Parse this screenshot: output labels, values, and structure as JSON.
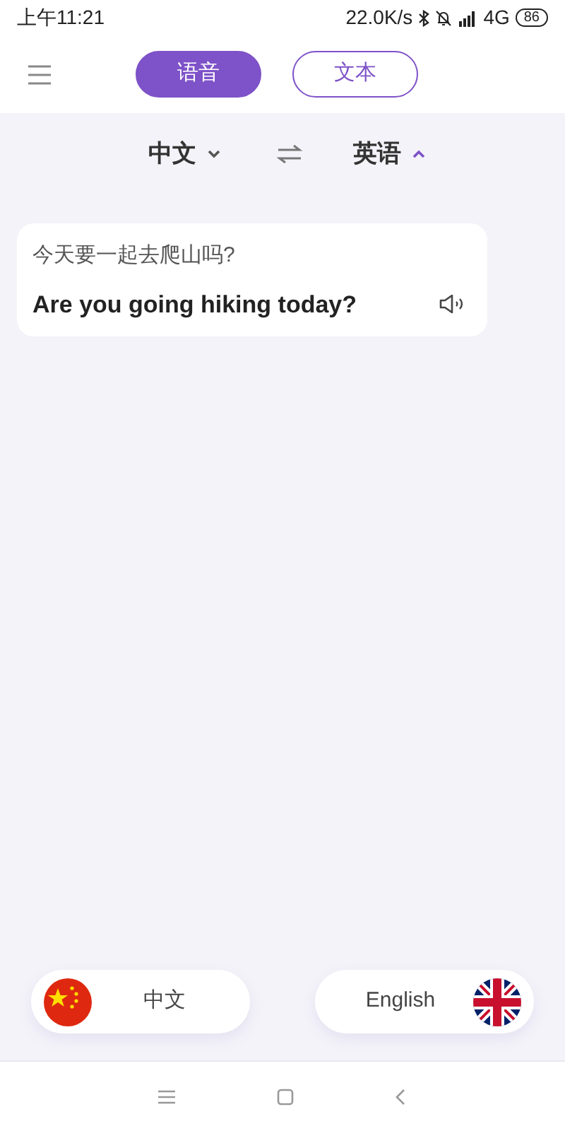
{
  "status_bar": {
    "time": "上午11:21",
    "speed": "22.0K/s",
    "network": "4G",
    "battery": "86"
  },
  "tabs": [
    {
      "label": "语音",
      "selected": true
    },
    {
      "label": "文本",
      "selected": false
    }
  ],
  "language_bar": {
    "source": {
      "label": "中文",
      "expanded": false
    },
    "target": {
      "label": "英语",
      "expanded": true
    }
  },
  "translations": [
    {
      "source": "今天要一起去爬山吗?",
      "result": "Are you going hiking today?"
    }
  ],
  "speak_buttons": [
    {
      "label": "中文",
      "kind": "china"
    },
    {
      "label": "English",
      "kind": "britain"
    }
  ]
}
